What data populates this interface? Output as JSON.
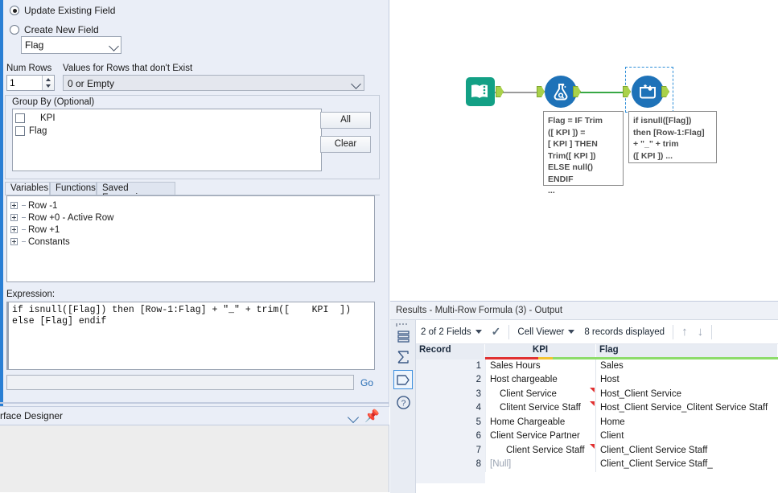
{
  "config": {
    "update_existing_label": "Update Existing Field",
    "create_new_label": "Create New  Field",
    "field_value": "Flag",
    "num_rows_label": "Num Rows",
    "num_rows_value": "1",
    "values_rows_label": "Values for Rows that don't Exist",
    "values_rows_value": "0 or Empty",
    "group_by_label": "Group By (Optional)",
    "group_by_items": [
      {
        "label": "KPI",
        "checked": false
      },
      {
        "label": "Flag",
        "checked": false
      }
    ],
    "all_button": "All",
    "clear_button": "Clear",
    "tabs": [
      {
        "label": "Variables",
        "active": true
      },
      {
        "label": "Functions",
        "active": false
      },
      {
        "label": "Saved Expressions",
        "active": false
      }
    ],
    "variables_tree": [
      {
        "label": "Row -1"
      },
      {
        "label": "Row +0 - Active Row"
      },
      {
        "label": "Row +1"
      },
      {
        "label": "Constants"
      }
    ],
    "expression_label": "Expression:",
    "expression_value": "if isnull([Flag]) then [Row-1:Flag] + \"_\" + trim([    KPI  ]) else [Flag] endif",
    "search_placeholder": "",
    "go_label": "Go"
  },
  "interface_designer": {
    "title": "rface Designer",
    "caret_icon": "chevron-down-icon",
    "pin_icon": "pin-icon"
  },
  "canvas": {
    "tools": [
      {
        "name": "input-data-tool",
        "icon": "book-icon",
        "color": "#13a085"
      },
      {
        "name": "formula-tool",
        "icon": "flask-icon",
        "color": "#1e72b8"
      },
      {
        "name": "multi-row-formula-tool",
        "icon": "multi-row-formula-icon",
        "color": "#1e72b8",
        "selected": true
      }
    ],
    "annotations": [
      {
        "name": "formula-annotation",
        "text": "Flag = IF Trim\n([   KPI  ]) =\n[  KPI  ] THEN\nTrim([   KPI  ])\nELSE null() ENDIF\n..."
      },
      {
        "name": "multi-row-formula-annotation",
        "text": "if isnull([Flag])\nthen [Row-1:Flag]\n+ \"_\" + trim\n([   KPI  ]) ..."
      }
    ]
  },
  "results": {
    "title": "Results - Multi-Row Formula (3) - Output",
    "toolbar": {
      "fields_label": "2 of 2 Fields",
      "check_icon": "check-icon",
      "viewer_label": "Cell Viewer",
      "records_label": "8 records displayed",
      "up_icon": "arrow-up-icon",
      "down_icon": "arrow-down-icon"
    },
    "rail_icons": [
      {
        "name": "messages-icon",
        "glyph": "≡",
        "selected": false
      },
      {
        "name": "sum-icon",
        "glyph": "Σ",
        "selected": false
      },
      {
        "name": "output-data-icon",
        "glyph": "⬠",
        "selected": true
      },
      {
        "name": "help-icon",
        "glyph": "?",
        "selected": false
      }
    ],
    "columns": [
      {
        "key": "record",
        "label": "Record",
        "bar": []
      },
      {
        "key": "kpi",
        "label": "KPI",
        "bar": [
          {
            "color": "#e03131",
            "pct": 48
          },
          {
            "color": "#f2c230",
            "pct": 13
          },
          {
            "color": "#8ddc6a",
            "pct": 39
          }
        ]
      },
      {
        "key": "flag",
        "label": "Flag",
        "bar": [
          {
            "color": "#8ddc6a",
            "pct": 100
          }
        ]
      }
    ],
    "rows": [
      {
        "record": "1",
        "kpi": "Sales Hours",
        "kpi_indent": 0,
        "kpi_flag": false,
        "kpi_null": false,
        "flag": "Sales"
      },
      {
        "record": "2",
        "kpi": "Host chargeable",
        "kpi_indent": 0,
        "kpi_flag": false,
        "kpi_null": false,
        "flag": "Host"
      },
      {
        "record": "3",
        "kpi": "Client Service",
        "kpi_indent": 12,
        "kpi_flag": true,
        "kpi_null": false,
        "flag": "Host_Client Service"
      },
      {
        "record": "4",
        "kpi": "Clitent Service Staff",
        "kpi_indent": 12,
        "kpi_flag": true,
        "kpi_null": false,
        "flag": "Host_Client Service_Clitent Service Staff"
      },
      {
        "record": "5",
        "kpi": "Home Chargeable",
        "kpi_indent": 0,
        "kpi_flag": false,
        "kpi_null": false,
        "flag": "Home"
      },
      {
        "record": "6",
        "kpi": "Client Service Partner",
        "kpi_indent": 0,
        "kpi_flag": false,
        "kpi_null": false,
        "flag": "Client"
      },
      {
        "record": "7",
        "kpi": "Client Service Staff",
        "kpi_indent": 20,
        "kpi_flag": true,
        "kpi_null": false,
        "flag": "Client_Client Service Staff"
      },
      {
        "record": "8",
        "kpi": "[Null]",
        "kpi_indent": 0,
        "kpi_flag": false,
        "kpi_null": true,
        "flag": "Client_Client Service Staff_"
      }
    ]
  }
}
